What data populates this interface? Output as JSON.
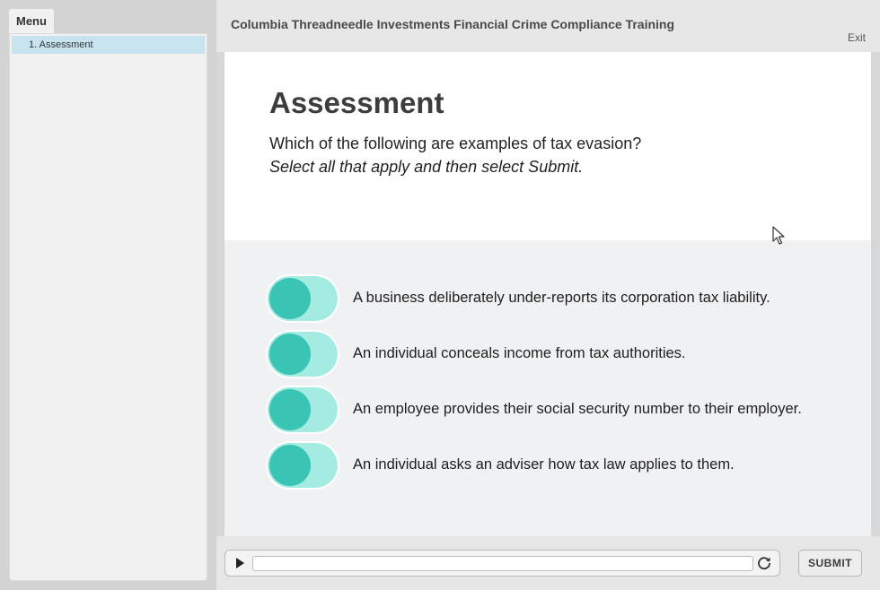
{
  "app": {
    "course_title": "Columbia Threadneedle Investments Financial Crime Compliance Training",
    "exit_label": "Exit"
  },
  "sidebar": {
    "tab_label": "Menu",
    "items": [
      {
        "label": "1. Assessment",
        "selected": true
      }
    ]
  },
  "slide": {
    "heading": "Assessment",
    "question": "Which of the following are examples of tax evasion?",
    "instruction": "Select all that apply and then select Submit.",
    "options": [
      {
        "label": "A business deliberately under-reports its corporation tax liability.",
        "selected": false
      },
      {
        "label": "An individual conceals income from tax authorities.",
        "selected": false
      },
      {
        "label": "An employee provides their social security number to their employer.",
        "selected": false
      },
      {
        "label": "An individual asks an adviser how tax law applies to them.",
        "selected": false
      }
    ]
  },
  "player": {
    "play_icon": "play-icon",
    "replay_icon": "replay-icon",
    "progress": 0,
    "submit_label": "SUBMIT"
  },
  "colors": {
    "toggle_track": "#a4ece2",
    "toggle_knob": "#3ac4b3",
    "menu_selected": "#c7e3f0"
  }
}
